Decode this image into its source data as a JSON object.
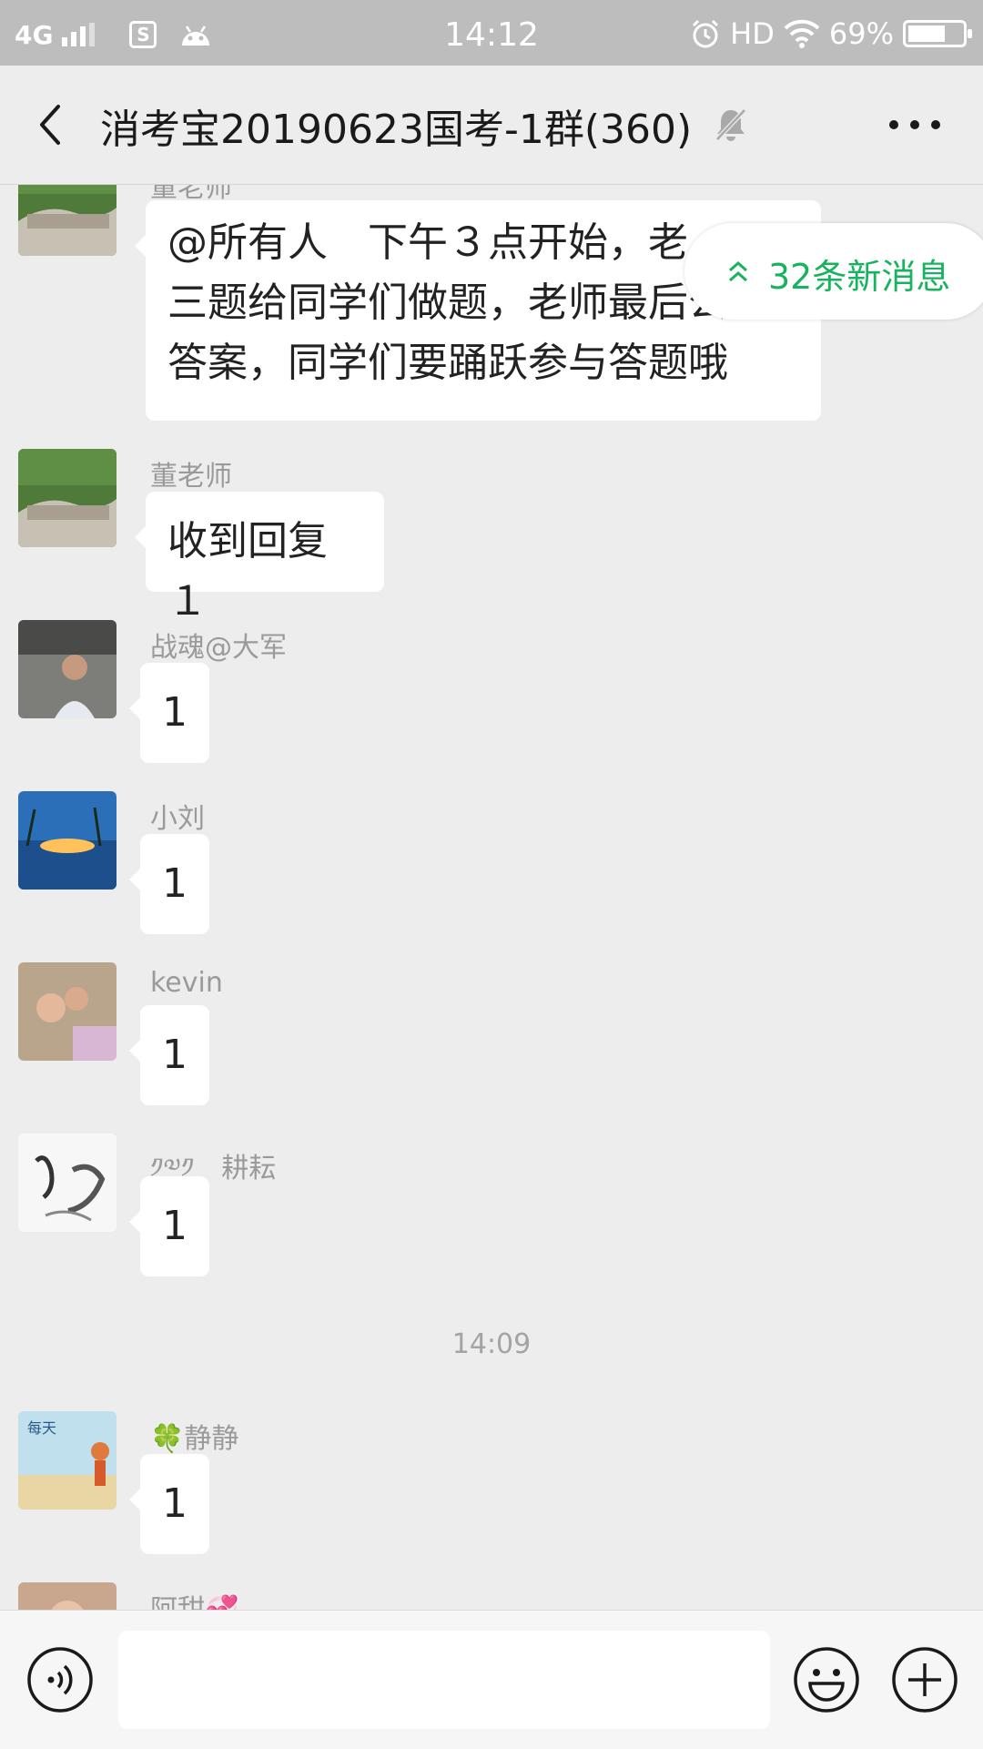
{
  "status_bar": {
    "network": "4G",
    "time": "14:12",
    "hd": "HD",
    "battery": "69%",
    "battery_level": 0.69
  },
  "header": {
    "title": "消考宝20190623国考-1群(360)",
    "icons": [
      "back-arrow-icon",
      "mute-bell-icon",
      "more-icon"
    ]
  },
  "new_messages_pill": "32条新消息",
  "messages": [
    {
      "sender": "董老师",
      "text_lines": [
        "@所有人　下午３点开始，老",
        "三题给同学们做题，老师最后公布",
        "答案，同学们要踊跃参与答题哦"
      ]
    },
    {
      "sender": "董老师",
      "text": "收到回复１"
    },
    {
      "sender": "战魂@大军",
      "text": "1"
    },
    {
      "sender": "小刘",
      "text": "1"
    },
    {
      "sender": "kevin",
      "text": "1"
    },
    {
      "sender": "༡༧༡　耕耘",
      "text": "1"
    },
    {
      "timestamp": "14:09"
    },
    {
      "sender": "🍀静静",
      "text": "1"
    },
    {
      "sender": "阿甜💞"
    }
  ],
  "input_bar": {
    "icons": [
      "voice-icon",
      "emoji-icon",
      "plus-icon"
    ],
    "input_value": ""
  },
  "colors": {
    "background": "#ededed",
    "accent_green": "#17b35e",
    "bubble": "#ffffff",
    "status_bar": "#bdbdbd"
  }
}
